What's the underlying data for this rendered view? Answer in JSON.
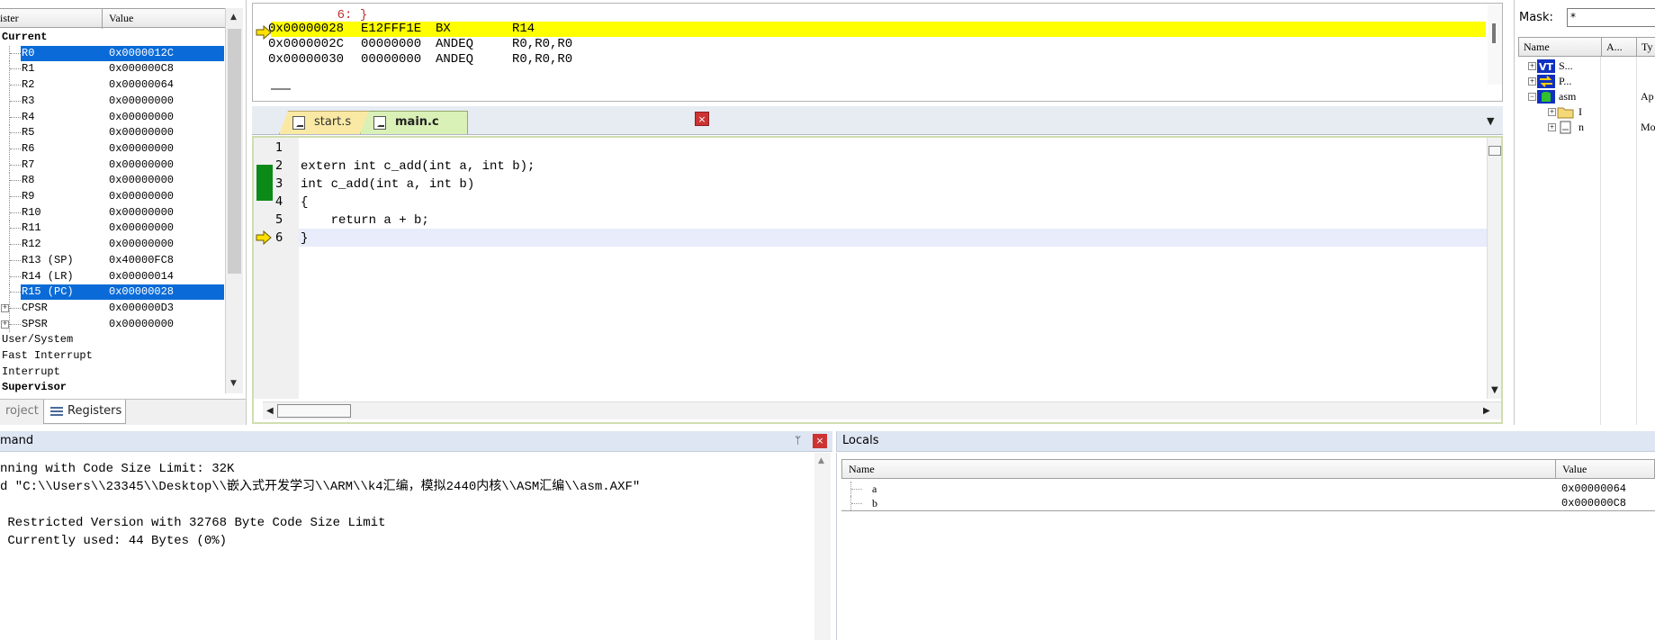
{
  "registers": {
    "col_register": "ister",
    "col_value": "Value",
    "rows": [
      {
        "name": "Current",
        "value": "",
        "bold": true,
        "indent": 0
      },
      {
        "name": "R0",
        "value": "0x0000012C",
        "selected": true,
        "indent": 1
      },
      {
        "name": "R1",
        "value": "0x000000C8",
        "indent": 1
      },
      {
        "name": "R2",
        "value": "0x00000064",
        "indent": 1
      },
      {
        "name": "R3",
        "value": "0x00000000",
        "indent": 1
      },
      {
        "name": "R4",
        "value": "0x00000000",
        "indent": 1
      },
      {
        "name": "R5",
        "value": "0x00000000",
        "indent": 1
      },
      {
        "name": "R6",
        "value": "0x00000000",
        "indent": 1
      },
      {
        "name": "R7",
        "value": "0x00000000",
        "indent": 1
      },
      {
        "name": "R8",
        "value": "0x00000000",
        "indent": 1
      },
      {
        "name": "R9",
        "value": "0x00000000",
        "indent": 1
      },
      {
        "name": "R10",
        "value": "0x00000000",
        "indent": 1
      },
      {
        "name": "R11",
        "value": "0x00000000",
        "indent": 1
      },
      {
        "name": "R12",
        "value": "0x00000000",
        "indent": 1
      },
      {
        "name": "R13 (SP)",
        "value": "0x40000FC8",
        "indent": 1
      },
      {
        "name": "R14 (LR)",
        "value": "0x00000014",
        "indent": 1
      },
      {
        "name": "R15 (PC)",
        "value": "0x00000028",
        "selected": true,
        "indent": 1
      },
      {
        "name": "CPSR",
        "value": "0x000000D3",
        "indent": 1,
        "expandable": true
      },
      {
        "name": "SPSR",
        "value": "0x00000000",
        "indent": 1,
        "expandable": true
      },
      {
        "name": "User/System",
        "value": "",
        "indent": 0
      },
      {
        "name": "Fast Interrupt",
        "value": "",
        "indent": 0
      },
      {
        "name": "Interrupt",
        "value": "",
        "indent": 0
      },
      {
        "name": "Supervisor",
        "value": "",
        "bold": true,
        "indent": 0
      }
    ],
    "tabs": {
      "project": "roject",
      "registers": "Registers"
    }
  },
  "disassembly": {
    "source_line": "6: }",
    "lines": [
      {
        "addr": "0x00000028",
        "code": "E12FFF1E",
        "op": "BX",
        "args": "R14",
        "current": true
      },
      {
        "addr": "0x0000002C",
        "code": "00000000",
        "op": "ANDEQ",
        "args": "R0,R0,R0"
      },
      {
        "addr": "0x00000030",
        "code": "00000000",
        "op": "ANDEQ",
        "args": "R0,R0,R0"
      }
    ]
  },
  "editor": {
    "tabs": [
      {
        "label": "start.s",
        "active": false
      },
      {
        "label": "main.c",
        "active": true
      }
    ],
    "close_glyph": "×",
    "dropdown_glyph": "▼",
    "lines": [
      {
        "num": "1",
        "text": ""
      },
      {
        "num": "2",
        "text": "extern int c_add(int a, int b);"
      },
      {
        "num": "3",
        "text": "int c_add(int a, int b)"
      },
      {
        "num": "4",
        "text": "{"
      },
      {
        "num": "5",
        "text": "    return a + b;"
      },
      {
        "num": "6",
        "text": "}"
      }
    ]
  },
  "symbols": {
    "mask_label": "Mask:",
    "mask_value": "*",
    "col_name": "Name",
    "col_a": "A...",
    "col_type": "Ty",
    "rows": [
      {
        "label": "S...",
        "type": ""
      },
      {
        "label": "P...",
        "type": ""
      },
      {
        "label": "asm",
        "type": "Ap"
      },
      {
        "label": "I",
        "type": ""
      },
      {
        "label": "n",
        "type": "Mo"
      }
    ]
  },
  "command": {
    "title": "mand",
    "pin_glyph": "ᛘ",
    "close_glyph": "×",
    "lines": [
      "nning with Code Size Limit: 32K",
      "d \"C:\\\\Users\\\\23345\\\\Desktop\\\\嵌入式开发学习\\\\ARM\\\\k4汇编，模拟2440内核\\\\ASM汇编\\\\asm.AXF\"",
      "",
      " Restricted Version with 32768 Byte Code Size Limit",
      " Currently used: 44 Bytes (0%)"
    ]
  },
  "locals": {
    "title": "Locals",
    "col_name": "Name",
    "col_value": "Value",
    "rows": [
      {
        "name": "a",
        "value": "0x00000064"
      },
      {
        "name": "b",
        "value": "0x000000C8"
      }
    ]
  },
  "colors": {
    "selection": "#0a6bd8",
    "current_instruction": "#ffff00",
    "breakpoint": "#0b8a18",
    "close_button": "#cc3333"
  }
}
